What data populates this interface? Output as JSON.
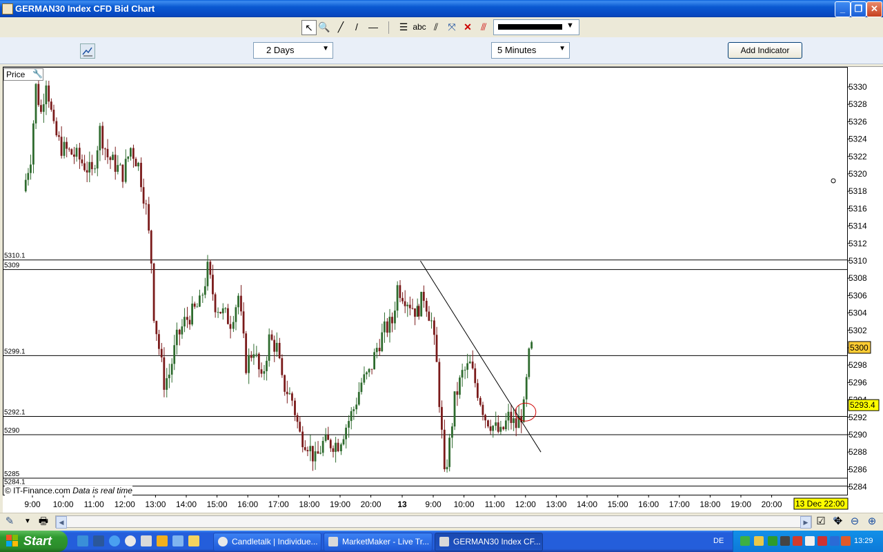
{
  "window": {
    "title": "GERMAN30 Index CFD Bid Chart"
  },
  "toolbar": {
    "icons": [
      "cursor-icon",
      "zoom-icon",
      "line-icon",
      "trendline-icon",
      "horizontal-line-icon",
      "fibonacci-icon",
      "text-tool-icon",
      "channel-icon",
      "crosshair-icon",
      "delete-icon",
      "erase-all-icon"
    ],
    "text_tool_label": "abc",
    "line_color": "#000000"
  },
  "controls": {
    "period": "2 Days",
    "interval": "5 Minutes",
    "add_indicator": "Add Indicator"
  },
  "chart": {
    "panel_label": "Price",
    "copyright_prefix": "© IT-Finance.com",
    "copyright_suffix": "Data is real time",
    "current_price_label": "5300",
    "current_price_box_text": "5293.4",
    "date_box": "13 Dec 22:00",
    "colors": {
      "up": "#2e6b2e",
      "down": "#7a1a1a",
      "highlight": "#ffff00",
      "price_box": "#ffcc33",
      "circle": "#d00000"
    }
  },
  "chart_data": {
    "type": "candlestick",
    "title": "GERMAN30 Index CFD Bid Chart",
    "interval": "5 Minutes",
    "period": "2 Days",
    "ylim": [
      5283,
      5332
    ],
    "y_ticks": [
      5284,
      5286,
      5288,
      5290,
      5292,
      5294,
      5296,
      5298,
      5300,
      5302,
      5304,
      5306,
      5308,
      5310,
      5312,
      5314,
      5316,
      5318,
      5320,
      5322,
      5324,
      5326,
      5328,
      5330
    ],
    "y_tick_labels": [
      "5284",
      "5286",
      "5288",
      "5290",
      "5292",
      "5294",
      "5296",
      "5298",
      "5300",
      "5302",
      "5304",
      "5306",
      "5308",
      "5310",
      "5312",
      "5314",
      "5316",
      "5318",
      "5320",
      "5322",
      "5324",
      "5326",
      "5328",
      "5330"
    ],
    "x_tick_labels": [
      "9:00",
      "10:00",
      "11:00",
      "12:00",
      "13:00",
      "14:00",
      "15:00",
      "16:00",
      "17:00",
      "18:00",
      "19:00",
      "20:00",
      "13",
      "9:00",
      "10:00",
      "11:00",
      "12:00",
      "13:00",
      "14:00",
      "15:00",
      "16:00",
      "17:00",
      "18:00",
      "19:00",
      "20:00"
    ],
    "horizontal_lines": [
      {
        "label": "5310.1",
        "value": 5310.1
      },
      {
        "label": "5309",
        "value": 5309.0
      },
      {
        "label": "5299.1",
        "value": 5299.1
      },
      {
        "label": "5292.1",
        "value": 5292.1
      },
      {
        "label": "5290",
        "value": 5290.0
      },
      {
        "label": "5285",
        "value": 5285.0
      },
      {
        "label": "5284.1",
        "value": 5284.1
      }
    ],
    "trendline": {
      "from": {
        "time": "13 8:35",
        "price": 5310
      },
      "to": {
        "time": "13 12:30",
        "price": 5288
      }
    },
    "close_path": [
      [
        "8:45",
        5318
      ],
      [
        "9:00",
        5322
      ],
      [
        "9:10",
        5330
      ],
      [
        "9:20",
        5327
      ],
      [
        "9:30",
        5331
      ],
      [
        "9:45",
        5325
      ],
      [
        "10:00",
        5323
      ],
      [
        "10:30",
        5322
      ],
      [
        "11:00",
        5320
      ],
      [
        "11:15",
        5325
      ],
      [
        "11:30",
        5322
      ],
      [
        "12:00",
        5320
      ],
      [
        "12:15",
        5323
      ],
      [
        "12:30",
        5321
      ],
      [
        "12:45",
        5316
      ],
      [
        "12:55",
        5310
      ],
      [
        "13:00",
        5304
      ],
      [
        "13:10",
        5300
      ],
      [
        "13:20",
        5296
      ],
      [
        "13:30",
        5297
      ],
      [
        "13:45",
        5301
      ],
      [
        "14:00",
        5303
      ],
      [
        "14:30",
        5305
      ],
      [
        "14:45",
        5309
      ],
      [
        "15:00",
        5305
      ],
      [
        "15:30",
        5303
      ],
      [
        "15:45",
        5306
      ],
      [
        "16:00",
        5298
      ],
      [
        "16:15",
        5300
      ],
      [
        "16:30",
        5296
      ],
      [
        "16:45",
        5301
      ],
      [
        "17:00",
        5300
      ],
      [
        "17:10",
        5296
      ],
      [
        "17:30",
        5294
      ],
      [
        "17:45",
        5290
      ],
      [
        "18:00",
        5289
      ],
      [
        "18:15",
        5287
      ],
      [
        "18:30",
        5289
      ],
      [
        "19:00",
        5289
      ],
      [
        "19:15",
        5291
      ],
      [
        "19:30",
        5293
      ],
      [
        "19:45",
        5296
      ],
      [
        "20:00",
        5297
      ],
      [
        "20:15",
        5300
      ],
      [
        "20:30",
        5302
      ],
      [
        "20:45",
        5303
      ],
      [
        "20:55",
        5307
      ],
      [
        "13 8:30",
        5304
      ],
      [
        "13 8:45",
        5306
      ],
      [
        "13 9:00",
        5303
      ],
      [
        "13 9:10",
        5298
      ],
      [
        "13 9:20",
        5290
      ],
      [
        "13 9:25",
        5285
      ],
      [
        "13 9:35",
        5289
      ],
      [
        "13 9:45",
        5294
      ],
      [
        "13 10:00",
        5297
      ],
      [
        "13 10:15",
        5298
      ],
      [
        "13 10:30",
        5295
      ],
      [
        "13 10:45",
        5292
      ],
      [
        "13 11:00",
        5291
      ],
      [
        "13 11:15",
        5290
      ],
      [
        "13 11:30",
        5292
      ],
      [
        "13 11:45",
        5291
      ],
      [
        "13 12:00",
        5293
      ],
      [
        "13 12:10",
        5299
      ],
      [
        "13 12:15",
        5300
      ]
    ]
  },
  "bottom_bar": {
    "icons": [
      "pin-icon",
      "dropdown-icon",
      "print-icon",
      "checkbox-icon",
      "edit-icon",
      "delete-icon",
      "pan-icon",
      "zoom-out-icon",
      "zoom-in-icon"
    ]
  },
  "taskbar": {
    "start_label": "Start",
    "tasks": [
      {
        "label": "Candletalk | Individue...",
        "icon": "browser-icon"
      },
      {
        "label": "MarketMaker - Live Tr...",
        "icon": "marketmaker-icon"
      },
      {
        "label": "GERMAN30 Index CF...",
        "icon": "marketmaker-icon"
      }
    ],
    "language": "DE",
    "clock": "13:29"
  }
}
